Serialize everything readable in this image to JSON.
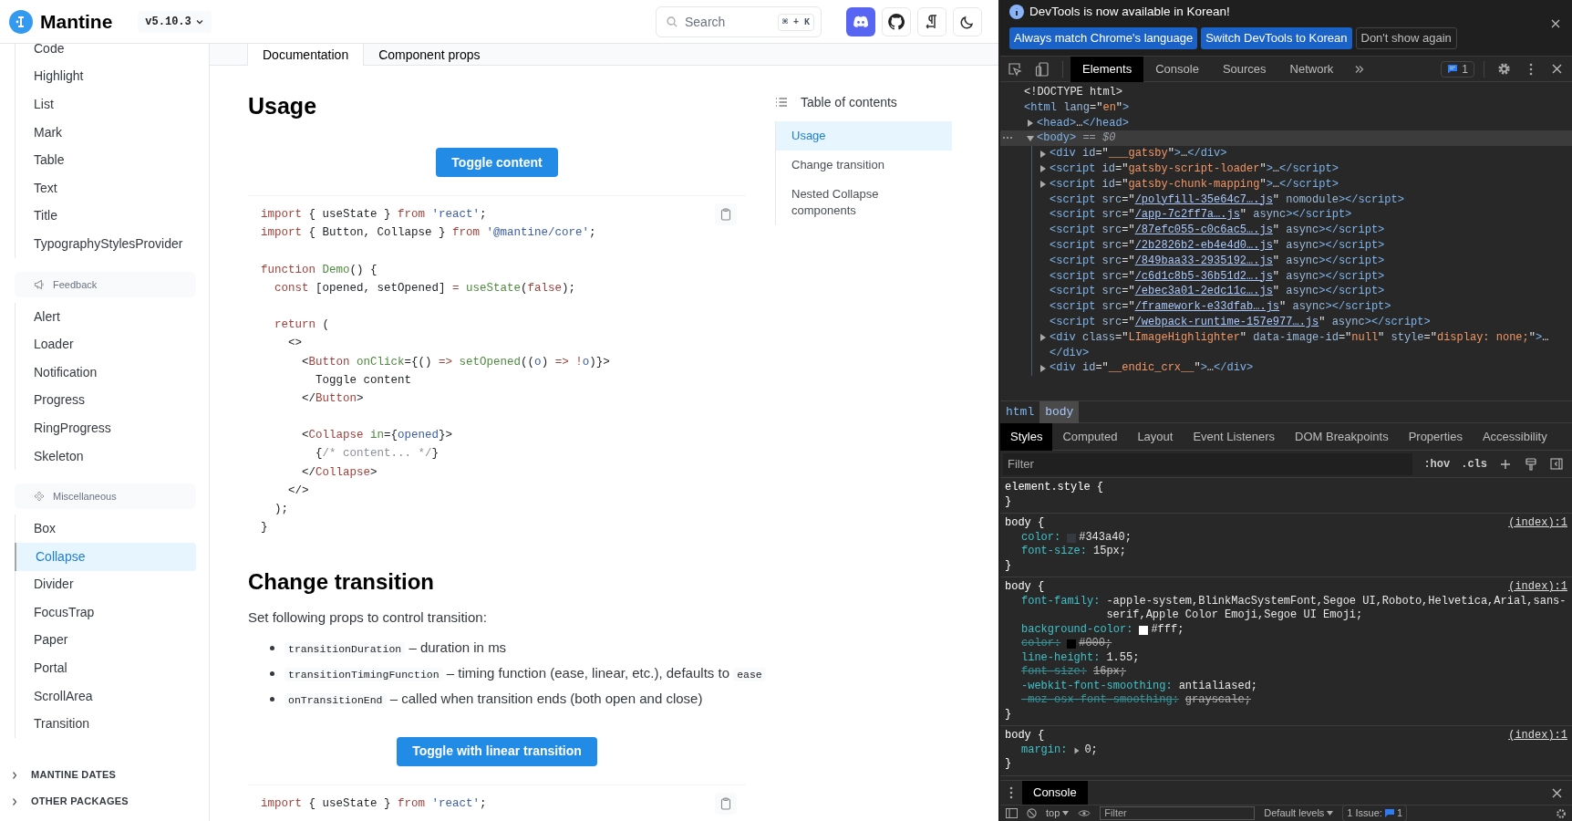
{
  "header": {
    "logo": "Mantine",
    "version": "v5.10.3",
    "search": {
      "placeholder": "Search",
      "shortcut": "⌘ + K"
    }
  },
  "sidebar": {
    "groups": [
      {
        "items": [
          {
            "label": "Code",
            "selected": false
          },
          {
            "label": "Highlight",
            "selected": false
          },
          {
            "label": "List",
            "selected": false
          },
          {
            "label": "Mark",
            "selected": false
          },
          {
            "label": "Table",
            "selected": false
          },
          {
            "label": "Text",
            "selected": false
          },
          {
            "label": "Title",
            "selected": false
          },
          {
            "label": "TypographyStylesProvider",
            "selected": false
          }
        ]
      },
      {
        "title": "Feedback",
        "items": [
          {
            "label": "Alert",
            "selected": false
          },
          {
            "label": "Loader",
            "selected": false
          },
          {
            "label": "Notification",
            "selected": false
          },
          {
            "label": "Progress",
            "selected": false
          },
          {
            "label": "RingProgress",
            "selected": false
          },
          {
            "label": "Skeleton",
            "selected": false
          }
        ]
      },
      {
        "title": "Miscellaneous",
        "items": [
          {
            "label": "Box",
            "selected": false
          },
          {
            "label": "Collapse",
            "selected": true
          },
          {
            "label": "Divider",
            "selected": false
          },
          {
            "label": "FocusTrap",
            "selected": false
          },
          {
            "label": "Paper",
            "selected": false
          },
          {
            "label": "Portal",
            "selected": false
          },
          {
            "label": "ScrollArea",
            "selected": false
          },
          {
            "label": "Transition",
            "selected": false
          }
        ]
      }
    ],
    "sections": [
      {
        "label": "MANTINE DATES",
        "expanded": false
      },
      {
        "label": "OTHER PACKAGES",
        "expanded": false
      }
    ]
  },
  "tabs": [
    {
      "label": "Documentation",
      "selected": true
    },
    {
      "label": "Component props",
      "selected": false
    }
  ],
  "usage": {
    "heading": "Usage",
    "button": "Toggle content",
    "code": [
      [
        [
          {
            "kind": "kw",
            "text": "import"
          },
          {
            "kind": "p",
            "text": " { useState } "
          },
          {
            "kind": "kw",
            "text": "from"
          },
          {
            "kind": "str",
            "text": " 'react'"
          },
          {
            "kind": "p",
            "text": ";"
          }
        ],
        [
          {
            "kind": "kw",
            "text": "import"
          },
          {
            "kind": "p",
            "text": " { Button, Collapse } "
          },
          {
            "kind": "kw",
            "text": "from"
          },
          {
            "kind": "str",
            "text": " '@mantine/core'"
          },
          {
            "kind": "p",
            "text": ";"
          }
        ]
      ],
      [
        [
          {
            "kind": "kw",
            "text": "function"
          },
          {
            "kind": "fn",
            "text": " Demo"
          },
          {
            "kind": "p",
            "text": "() {"
          }
        ],
        [
          {
            "kind": "kw",
            "text": "  const"
          },
          {
            "kind": "p",
            "text": " [opened, setOpened] "
          },
          {
            "kind": "kw",
            "text": "="
          },
          {
            "kind": "fn",
            "text": " useState"
          },
          {
            "kind": "p",
            "text": "("
          },
          {
            "kind": "kw",
            "text": "false"
          },
          {
            "kind": "p",
            "text": ");"
          }
        ]
      ],
      [
        [
          {
            "kind": "kw",
            "text": "  return"
          },
          {
            "kind": "p",
            "text": " ("
          }
        ],
        [
          {
            "kind": "p",
            "text": "    <>"
          }
        ],
        [
          {
            "kind": "p",
            "text": "      <"
          },
          {
            "kind": "kw",
            "text": "Button"
          },
          {
            "kind": "fn",
            "text": " onClick"
          },
          {
            "kind": "p",
            "text": "={() "
          },
          {
            "kind": "kw",
            "text": "=>"
          },
          {
            "kind": "fn",
            "text": " setOpened"
          },
          {
            "kind": "p",
            "text": "(("
          },
          {
            "kind": "var",
            "text": "o"
          },
          {
            "kind": "p",
            "text": ") "
          },
          {
            "kind": "kw",
            "text": "=>"
          },
          {
            "kind": "kw",
            "text": " !"
          },
          {
            "kind": "var",
            "text": "o"
          },
          {
            "kind": "p",
            "text": ")}>"
          }
        ],
        [
          {
            "kind": "p",
            "text": "        Toggle content"
          }
        ],
        [
          {
            "kind": "p",
            "text": "      </"
          },
          {
            "kind": "kw",
            "text": "Button"
          },
          {
            "kind": "p",
            "text": ">"
          }
        ]
      ],
      [
        [
          {
            "kind": "p",
            "text": "      <"
          },
          {
            "kind": "kw",
            "text": "Collapse"
          },
          {
            "kind": "fn",
            "text": " in"
          },
          {
            "kind": "p",
            "text": "={"
          },
          {
            "kind": "var",
            "text": "opened"
          },
          {
            "kind": "p",
            "text": "}>"
          }
        ],
        [
          {
            "kind": "p",
            "text": "        {"
          },
          {
            "kind": "cm",
            "text": "/* content... */"
          },
          {
            "kind": "p",
            "text": "}"
          }
        ],
        [
          {
            "kind": "p",
            "text": "      </"
          },
          {
            "kind": "kw",
            "text": "Collapse"
          },
          {
            "kind": "p",
            "text": ">"
          }
        ],
        [
          {
            "kind": "p",
            "text": "    </>"
          }
        ],
        [
          {
            "kind": "p",
            "text": "  );"
          }
        ],
        [
          {
            "kind": "p",
            "text": "}"
          }
        ]
      ]
    ]
  },
  "change_transition": {
    "heading": "Change transition",
    "intro": "Set following props to control transition:",
    "bullets": [
      [
        {
          "kind": "code",
          "text": "transitionDuration"
        },
        {
          "kind": "text",
          "text": " – duration in ms"
        }
      ],
      [
        {
          "kind": "code",
          "text": "transitionTimingFunction"
        },
        {
          "kind": "text",
          "text": " – timing function (ease, linear, etc.), defaults to "
        },
        {
          "kind": "code",
          "text": "ease"
        }
      ],
      [
        {
          "kind": "code",
          "text": "onTransitionEnd"
        },
        {
          "kind": "text",
          "text": " – called when transition ends (both open and close)"
        }
      ]
    ],
    "button": "Toggle with linear transition",
    "code": [
      [
        [
          {
            "kind": "kw",
            "text": "import"
          },
          {
            "kind": "p",
            "text": " { useState } "
          },
          {
            "kind": "kw",
            "text": "from"
          },
          {
            "kind": "str",
            "text": " 'react'"
          },
          {
            "kind": "p",
            "text": ";"
          }
        ]
      ]
    ]
  },
  "toc": {
    "title": "Table of contents",
    "items": [
      {
        "label": "Usage",
        "selected": true
      },
      {
        "label": "Change transition",
        "selected": false
      },
      {
        "label": "Nested Collapse components",
        "selected": false
      }
    ]
  },
  "devtools": {
    "banner": {
      "message": "DevTools is now available in Korean!",
      "buttons": [
        {
          "label": "Always match Chrome's language",
          "kind": "primary"
        },
        {
          "label": "Switch DevTools to Korean",
          "kind": "primary"
        },
        {
          "label": "Don't show again",
          "kind": "secondary"
        }
      ]
    },
    "tabs": [
      {
        "label": "Elements",
        "selected": true
      },
      {
        "label": "Console",
        "selected": false
      },
      {
        "label": "Sources",
        "selected": false
      },
      {
        "label": "Network",
        "selected": false
      }
    ],
    "issues": "1",
    "dom": [
      {
        "tokens": [
          {
            "kind": "p",
            "text": "<!DOCTYPE html>"
          }
        ]
      },
      {
        "tokens": [
          {
            "kind": "tag",
            "text": "<html "
          },
          {
            "kind": "attr",
            "text": "lang"
          },
          {
            "kind": "p",
            "text": "=\""
          },
          {
            "kind": "val",
            "text": "en"
          },
          {
            "kind": "p",
            "text": "\""
          },
          {
            "kind": "tag",
            "text": ">"
          }
        ],
        "children": [
          {
            "expanded": false,
            "selected": false,
            "tokens": [
              {
                "kind": "tag",
                "text": "<head>"
              },
              {
                "kind": "p",
                "text": "…"
              },
              {
                "kind": "tag",
                "text": "</head>"
              }
            ]
          },
          {
            "expanded": true,
            "selected": true,
            "tokens": [
              {
                "kind": "tag",
                "text": "<body>"
              },
              {
                "kind": "dim",
                "text": " == $0"
              }
            ],
            "children": [
              {
                "expanded": false,
                "selected": false,
                "tokens": [
                  {
                    "kind": "tag",
                    "text": "<div "
                  },
                  {
                    "kind": "attr",
                    "text": "id"
                  },
                  {
                    "kind": "p",
                    "text": "=\""
                  },
                  {
                    "kind": "val",
                    "text": "___gatsby"
                  },
                  {
                    "kind": "p",
                    "text": "\""
                  },
                  {
                    "kind": "tag",
                    "text": ">"
                  },
                  {
                    "kind": "p",
                    "text": "…"
                  },
                  {
                    "kind": "tag",
                    "text": "</div>"
                  }
                ]
              },
              {
                "expanded": false,
                "selected": false,
                "tokens": [
                  {
                    "kind": "tag",
                    "text": "<script "
                  },
                  {
                    "kind": "attr",
                    "text": "id"
                  },
                  {
                    "kind": "p",
                    "text": "=\""
                  },
                  {
                    "kind": "val",
                    "text": "gatsby-script-loader"
                  },
                  {
                    "kind": "p",
                    "text": "\""
                  },
                  {
                    "kind": "tag",
                    "text": ">"
                  },
                  {
                    "kind": "p",
                    "text": "…"
                  },
                  {
                    "kind": "tag",
                    "text": "</script>"
                  }
                ]
              },
              {
                "expanded": false,
                "selected": false,
                "tokens": [
                  {
                    "kind": "tag",
                    "text": "<script "
                  },
                  {
                    "kind": "attr",
                    "text": "id"
                  },
                  {
                    "kind": "p",
                    "text": "=\""
                  },
                  {
                    "kind": "val",
                    "text": "gatsby-chunk-mapping"
                  },
                  {
                    "kind": "p",
                    "text": "\""
                  },
                  {
                    "kind": "tag",
                    "text": ">"
                  },
                  {
                    "kind": "p",
                    "text": "…"
                  },
                  {
                    "kind": "tag",
                    "text": "</script>"
                  }
                ]
              },
              {
                "tokens": [
                  {
                    "kind": "tag",
                    "text": "<script "
                  },
                  {
                    "kind": "attr",
                    "text": "src"
                  },
                  {
                    "kind": "p",
                    "text": "=\""
                  },
                  {
                    "kind": "link",
                    "text": "/polyfill-35e64c7….js"
                  },
                  {
                    "kind": "p",
                    "text": "\" "
                  },
                  {
                    "kind": "attr",
                    "text": "nomodule"
                  },
                  {
                    "kind": "tag",
                    "text": "></script>"
                  }
                ]
              },
              {
                "tokens": [
                  {
                    "kind": "tag",
                    "text": "<script "
                  },
                  {
                    "kind": "attr",
                    "text": "src"
                  },
                  {
                    "kind": "p",
                    "text": "=\""
                  },
                  {
                    "kind": "link",
                    "text": "/app-7c2ff7a….js"
                  },
                  {
                    "kind": "p",
                    "text": "\" "
                  },
                  {
                    "kind": "attr",
                    "text": "async"
                  },
                  {
                    "kind": "tag",
                    "text": "></script>"
                  }
                ]
              },
              {
                "tokens": [
                  {
                    "kind": "tag",
                    "text": "<script "
                  },
                  {
                    "kind": "attr",
                    "text": "src"
                  },
                  {
                    "kind": "p",
                    "text": "=\""
                  },
                  {
                    "kind": "link",
                    "text": "/87efc055-c0c6ac5….js"
                  },
                  {
                    "kind": "p",
                    "text": "\" "
                  },
                  {
                    "kind": "attr",
                    "text": "async"
                  },
                  {
                    "kind": "tag",
                    "text": "></script>"
                  }
                ]
              },
              {
                "tokens": [
                  {
                    "kind": "tag",
                    "text": "<script "
                  },
                  {
                    "kind": "attr",
                    "text": "src"
                  },
                  {
                    "kind": "p",
                    "text": "=\""
                  },
                  {
                    "kind": "link",
                    "text": "/2b2826b2-eb4e4d0….js"
                  },
                  {
                    "kind": "p",
                    "text": "\" "
                  },
                  {
                    "kind": "attr",
                    "text": "async"
                  },
                  {
                    "kind": "tag",
                    "text": "></script>"
                  }
                ]
              },
              {
                "tokens": [
                  {
                    "kind": "tag",
                    "text": "<script "
                  },
                  {
                    "kind": "attr",
                    "text": "src"
                  },
                  {
                    "kind": "p",
                    "text": "=\""
                  },
                  {
                    "kind": "link",
                    "text": "/849baa33-2935192….js"
                  },
                  {
                    "kind": "p",
                    "text": "\" "
                  },
                  {
                    "kind": "attr",
                    "text": "async"
                  },
                  {
                    "kind": "tag",
                    "text": "></script>"
                  }
                ]
              },
              {
                "tokens": [
                  {
                    "kind": "tag",
                    "text": "<script "
                  },
                  {
                    "kind": "attr",
                    "text": "src"
                  },
                  {
                    "kind": "p",
                    "text": "=\""
                  },
                  {
                    "kind": "link",
                    "text": "/c6d1c8b5-36b51d2….js"
                  },
                  {
                    "kind": "p",
                    "text": "\" "
                  },
                  {
                    "kind": "attr",
                    "text": "async"
                  },
                  {
                    "kind": "tag",
                    "text": "></script>"
                  }
                ]
              },
              {
                "tokens": [
                  {
                    "kind": "tag",
                    "text": "<script "
                  },
                  {
                    "kind": "attr",
                    "text": "src"
                  },
                  {
                    "kind": "p",
                    "text": "=\""
                  },
                  {
                    "kind": "link",
                    "text": "/ebec3a01-2edc11c….js"
                  },
                  {
                    "kind": "p",
                    "text": "\" "
                  },
                  {
                    "kind": "attr",
                    "text": "async"
                  },
                  {
                    "kind": "tag",
                    "text": "></script>"
                  }
                ]
              },
              {
                "tokens": [
                  {
                    "kind": "tag",
                    "text": "<script "
                  },
                  {
                    "kind": "attr",
                    "text": "src"
                  },
                  {
                    "kind": "p",
                    "text": "=\""
                  },
                  {
                    "kind": "link",
                    "text": "/framework-e33dfab….js"
                  },
                  {
                    "kind": "p",
                    "text": "\" "
                  },
                  {
                    "kind": "attr",
                    "text": "async"
                  },
                  {
                    "kind": "tag",
                    "text": "></script>"
                  }
                ]
              },
              {
                "tokens": [
                  {
                    "kind": "tag",
                    "text": "<script "
                  },
                  {
                    "kind": "attr",
                    "text": "src"
                  },
                  {
                    "kind": "p",
                    "text": "=\""
                  },
                  {
                    "kind": "link",
                    "text": "/webpack-runtime-157e977….js"
                  },
                  {
                    "kind": "p",
                    "text": "\" "
                  },
                  {
                    "kind": "attr",
                    "text": "async"
                  },
                  {
                    "kind": "tag",
                    "text": "></script>"
                  }
                ]
              },
              {
                "expanded": false,
                "selected": false,
                "tokens": [
                  {
                    "kind": "tag",
                    "text": "<div "
                  },
                  {
                    "kind": "attr",
                    "text": "class"
                  },
                  {
                    "kind": "p",
                    "text": "=\""
                  },
                  {
                    "kind": "val",
                    "text": "LImageHighlighter"
                  },
                  {
                    "kind": "p",
                    "text": "\" "
                  },
                  {
                    "kind": "attr",
                    "text": "data-image-id"
                  },
                  {
                    "kind": "p",
                    "text": "=\""
                  },
                  {
                    "kind": "val",
                    "text": "null"
                  },
                  {
                    "kind": "p",
                    "text": "\" "
                  },
                  {
                    "kind": "attr",
                    "text": "style"
                  },
                  {
                    "kind": "p",
                    "text": "=\""
                  },
                  {
                    "kind": "val",
                    "text": "display: none;"
                  },
                  {
                    "kind": "p",
                    "text": "\""
                  },
                  {
                    "kind": "tag",
                    "text": ">"
                  },
                  {
                    "kind": "p",
                    "text": "…"
                  }
                ],
                "tail": [
                  {
                    "kind": "tag",
                    "text": "</div>"
                  }
                ]
              },
              {
                "expanded": false,
                "selected": false,
                "tokens": [
                  {
                    "kind": "tag",
                    "text": "<div "
                  },
                  {
                    "kind": "attr",
                    "text": "id"
                  },
                  {
                    "kind": "p",
                    "text": "=\""
                  },
                  {
                    "kind": "val",
                    "text": "__endic_crx__"
                  },
                  {
                    "kind": "p",
                    "text": "\""
                  },
                  {
                    "kind": "tag",
                    "text": ">"
                  },
                  {
                    "kind": "p",
                    "text": "…"
                  },
                  {
                    "kind": "tag",
                    "text": "</div>"
                  }
                ]
              }
            ]
          }
        ]
      }
    ],
    "breadcrumbs": [
      {
        "label": "html",
        "selected": false
      },
      {
        "label": "body",
        "selected": true
      }
    ],
    "style_tabs": [
      {
        "label": "Styles",
        "selected": true
      },
      {
        "label": "Computed",
        "selected": false
      },
      {
        "label": "Layout",
        "selected": false
      },
      {
        "label": "Event Listeners",
        "selected": false
      },
      {
        "label": "DOM Breakpoints",
        "selected": false
      },
      {
        "label": "Properties",
        "selected": false
      },
      {
        "label": "Accessibility",
        "selected": false
      }
    ],
    "filter": {
      "placeholder": "Filter",
      "hov": ":hov",
      "cls": ".cls"
    },
    "rules": [
      {
        "selector": "element.style {",
        "close": "}"
      },
      {
        "selector": "body {",
        "source": "(index):1",
        "close": "}",
        "decls": [
          {
            "prop": "color:",
            "value": "#343a40;",
            "color": "#343a40",
            "overridden": false,
            "expandable": false
          },
          {
            "prop": "font-size:",
            "value": "15px;",
            "overridden": false,
            "expandable": false
          }
        ]
      },
      {
        "selector": "body {",
        "source": "(index):1",
        "close": "}",
        "decls": [
          {
            "prop": "font-family:",
            "value": "-apple-system,BlinkMacSystemFont,Segoe UI,Roboto,Helvetica,Arial,sans-serif,Apple Color Emoji,Segoe UI Emoji;",
            "overridden": false,
            "expandable": false
          },
          {
            "prop": "background-color:",
            "value": "#fff;",
            "color": "#ffffff",
            "overridden": false,
            "expandable": false
          },
          {
            "prop": "color:",
            "value": "#000;",
            "color": "#000000",
            "overridden": true,
            "expandable": false
          },
          {
            "prop": "line-height:",
            "value": "1.55;",
            "overridden": false,
            "expandable": false
          },
          {
            "prop": "font-size:",
            "value": "16px;",
            "overridden": true,
            "expandable": false
          },
          {
            "prop": "-webkit-font-smoothing:",
            "value": "antialiased;",
            "overridden": false,
            "expandable": false
          },
          {
            "prop": "-moz-osx-font-smoothing:",
            "value": "grayscale;",
            "overridden": true,
            "expandable": false
          }
        ]
      },
      {
        "selector": "body {",
        "source": "(index):1",
        "close": "}",
        "decls": [
          {
            "prop": "margin:",
            "value": "0;",
            "overridden": false,
            "expandable": true
          }
        ]
      }
    ],
    "drawer": {
      "tab": "Console",
      "context": "top",
      "filter_placeholder": "Filter",
      "levels": "Default levels",
      "issues_label": "1 Issue:",
      "issues_count": "1"
    }
  }
}
